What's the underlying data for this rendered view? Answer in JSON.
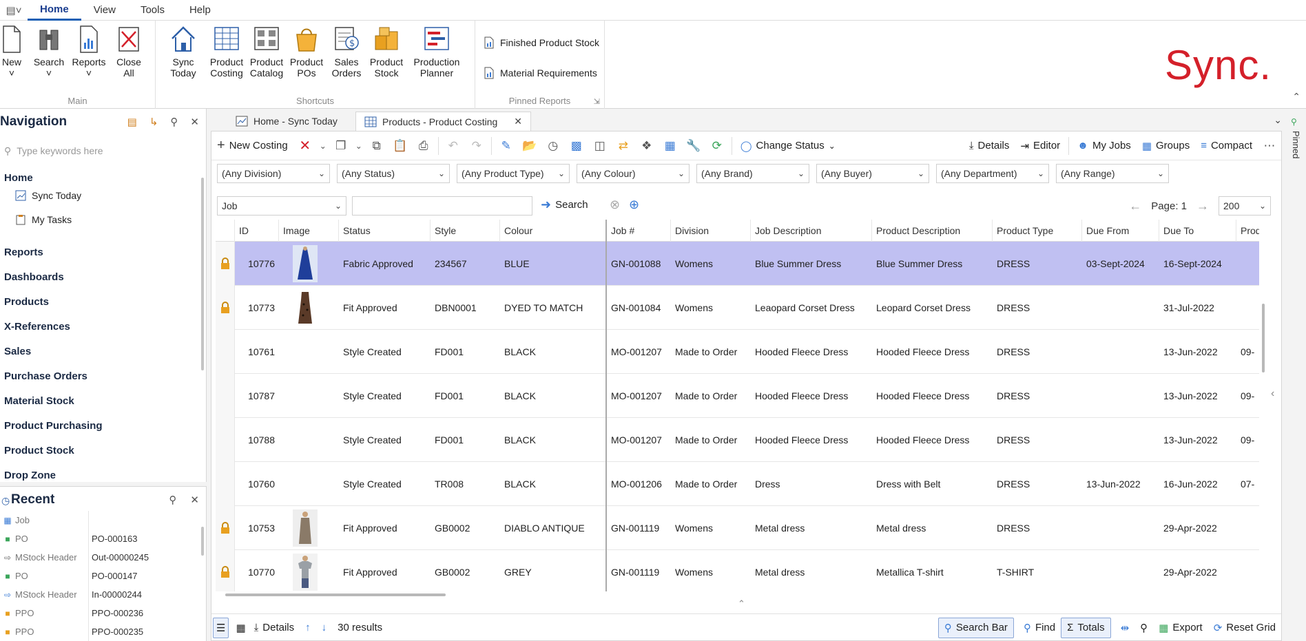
{
  "menubar": {
    "items": [
      "Home",
      "View",
      "Tools",
      "Help"
    ],
    "active": "Home"
  },
  "ribbon": {
    "main": {
      "title": "Main",
      "buttons": [
        {
          "label": "New",
          "sub": "˅"
        },
        {
          "label": "Search",
          "sub": "˅"
        },
        {
          "label": "Reports",
          "sub": "˅"
        },
        {
          "label": "Close",
          "sub": "All"
        }
      ]
    },
    "shortcuts": {
      "title": "Shortcuts",
      "buttons": [
        {
          "label": "Sync Today",
          "sub": ""
        },
        {
          "label": "Product",
          "sub": "Costing"
        },
        {
          "label": "Product",
          "sub": "Catalog"
        },
        {
          "label": "Product",
          "sub": "POs"
        },
        {
          "label": "Sales",
          "sub": "Orders"
        },
        {
          "label": "Product",
          "sub": "Stock"
        },
        {
          "label": "Production",
          "sub": "Planner"
        }
      ]
    },
    "pinned_reports": {
      "title": "Pinned Reports",
      "items": [
        "Finished Product Stock",
        "Material Requirements"
      ]
    },
    "logo": "Sync."
  },
  "navigation": {
    "title": "Navigation",
    "search_placeholder": "Type keywords here",
    "home": "Home",
    "home_items": [
      "Sync Today",
      "My Tasks"
    ],
    "sections": [
      "Reports",
      "Dashboards",
      "Products",
      "X-References",
      "Sales",
      "Purchase Orders",
      "Material Stock",
      "Product Purchasing",
      "Product Stock",
      "Drop Zone"
    ]
  },
  "recent": {
    "title": "Recent",
    "rows": [
      {
        "type": "Job",
        "value": "",
        "color": "#3a7bd5"
      },
      {
        "type": "PO",
        "value": "PO-000163",
        "color": "#3aa55a"
      },
      {
        "type": "MStock Header",
        "value": "Out-00000245",
        "color": "#666666"
      },
      {
        "type": "PO",
        "value": "PO-000147",
        "color": "#3aa55a"
      },
      {
        "type": "MStock Header",
        "value": "In-00000244",
        "color": "#3a7bd5"
      },
      {
        "type": "PPO",
        "value": "PPO-000236",
        "color": "#e8a020"
      },
      {
        "type": "PPO",
        "value": "PPO-000235",
        "color": "#e8a020"
      }
    ]
  },
  "tabs": [
    {
      "label": "Home - Sync Today",
      "active": false
    },
    {
      "label": "Products - Product Costing",
      "active": true
    }
  ],
  "toolbar": {
    "new_costing": "New Costing",
    "change_status": "Change Status",
    "details": "Details",
    "editor": "Editor",
    "my_jobs": "My Jobs",
    "groups": "Groups",
    "compact": "Compact"
  },
  "filters": [
    "(Any Division)",
    "(Any Status)",
    "(Any Product Type)",
    "(Any Colour)",
    "(Any Brand)",
    "(Any Buyer)",
    "(Any Department)",
    "(Any Range)"
  ],
  "search": {
    "field": "Job",
    "value": "",
    "button": "Search",
    "page_label": "Page: 1",
    "page_size": "200"
  },
  "grid": {
    "columns": [
      "ID",
      "Image",
      "Status",
      "Style",
      "Colour",
      "Job #",
      "Division",
      "Job Description",
      "Product Description",
      "Product Type",
      "Due From",
      "Due To",
      "Produc"
    ],
    "rows": [
      {
        "locked": true,
        "id": "10776",
        "image": "dress-blue",
        "status": "Fabric Approved",
        "style": "234567",
        "colour": "BLUE",
        "job": "GN-001088",
        "division": "Womens",
        "job_desc": "Blue Summer Dress",
        "prod_desc": "Blue Summer Dress",
        "type": "DRESS",
        "due_from": "03-Sept-2024",
        "due_to": "16-Sept-2024",
        "extra": "",
        "selected": true
      },
      {
        "locked": true,
        "id": "10773",
        "image": "dress-leopard",
        "status": "Fit Approved",
        "style": "DBN0001",
        "colour": "DYED TO MATCH",
        "job": "GN-001084",
        "division": "Womens",
        "job_desc": "Leaopard Corset Dress",
        "prod_desc": "Leopard Corset Dress",
        "type": "DRESS",
        "due_from": "",
        "due_to": "31-Jul-2022",
        "extra": "",
        "selected": false
      },
      {
        "locked": false,
        "id": "10761",
        "image": "",
        "status": "Style Created",
        "style": "FD001",
        "colour": "BLACK",
        "job": "MO-001207",
        "division": "Made to Order",
        "job_desc": "Hooded Fleece Dress",
        "prod_desc": "Hooded Fleece Dress",
        "type": "DRESS",
        "due_from": "",
        "due_to": "13-Jun-2022",
        "extra": "09-",
        "selected": false
      },
      {
        "locked": false,
        "id": "10787",
        "image": "",
        "status": "Style Created",
        "style": "FD001",
        "colour": "BLACK",
        "job": "MO-001207",
        "division": "Made to Order",
        "job_desc": "Hooded Fleece Dress",
        "prod_desc": "Hooded Fleece Dress",
        "type": "DRESS",
        "due_from": "",
        "due_to": "13-Jun-2022",
        "extra": "09-",
        "selected": false
      },
      {
        "locked": false,
        "id": "10788",
        "image": "",
        "status": "Style Created",
        "style": "FD001",
        "colour": "BLACK",
        "job": "MO-001207",
        "division": "Made to Order",
        "job_desc": "Hooded Fleece Dress",
        "prod_desc": "Hooded Fleece Dress",
        "type": "DRESS",
        "due_from": "",
        "due_to": "13-Jun-2022",
        "extra": "09-",
        "selected": false
      },
      {
        "locked": false,
        "id": "10760",
        "image": "",
        "status": "Style Created",
        "style": "TR008",
        "colour": "BLACK",
        "job": "MO-001206",
        "division": "Made to Order",
        "job_desc": "Dress",
        "prod_desc": "Dress with Belt",
        "type": "DRESS",
        "due_from": "13-Jun-2022",
        "due_to": "16-Jun-2022",
        "extra": "07-",
        "selected": false
      },
      {
        "locked": true,
        "id": "10753",
        "image": "dress-metal",
        "status": "Fit Approved",
        "style": "GB0002",
        "colour": "DIABLO ANTIQUE",
        "job": "GN-001119",
        "division": "Womens",
        "job_desc": "Metal dress",
        "prod_desc": "Metal dress",
        "type": "DRESS",
        "due_from": "",
        "due_to": "29-Apr-2022",
        "extra": "",
        "selected": false
      },
      {
        "locked": true,
        "id": "10770",
        "image": "tshirt-grey",
        "status": "Fit Approved",
        "style": "GB0002",
        "colour": "GREY",
        "job": "GN-001119",
        "division": "Womens",
        "job_desc": "Metal dress",
        "prod_desc": "Metallica T-shirt",
        "type": "T-SHIRT",
        "due_from": "",
        "due_to": "29-Apr-2022",
        "extra": "",
        "selected": false
      }
    ]
  },
  "statusbar": {
    "details": "Details",
    "results": "30 results",
    "search_bar": "Search Bar",
    "find": "Find",
    "totals": "Totals",
    "export": "Export",
    "reset_grid": "Reset Grid"
  },
  "pinned_strip": "Pinned"
}
